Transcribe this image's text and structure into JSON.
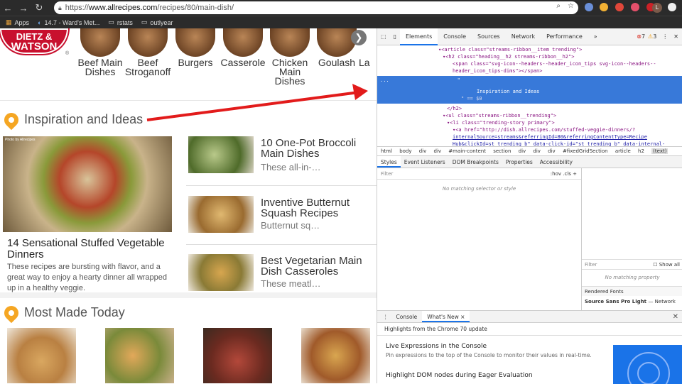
{
  "browser": {
    "url_prefix": "https://",
    "url_host": "www.allrecipes.com",
    "url_path": "/recipes/80/main-dish/",
    "back_icon": "arrow-left-icon",
    "forward_icon": "arrow-right-icon",
    "reload_icon": "reload-icon",
    "avatar_letter": "L",
    "bookmarks": [
      {
        "label": "Apps"
      },
      {
        "label": "14.7 - Ward's Met..."
      },
      {
        "label": "rstats"
      },
      {
        "label": "outlyear"
      }
    ]
  },
  "page": {
    "logo_text_1": "DIETZ &",
    "logo_text_2": "WATSON",
    "logo_reg": "®",
    "categories": [
      {
        "label": "Beef Main Dishes"
      },
      {
        "label": "Beef Stroganoff"
      },
      {
        "label": "Burgers"
      },
      {
        "label": "Casserole"
      },
      {
        "label": "Chicken Main Dishes"
      },
      {
        "label": "Goulash"
      },
      {
        "label": "La"
      }
    ],
    "next_arrow": "❯",
    "inspiration_title": "Inspiration and Ideas",
    "photo_credit": "Photo by Allrecipes",
    "feature_title": "14 Sensational Stuffed Vegetable Dinners",
    "feature_desc": "These recipes are bursting with flavor, and a great way to enjoy a hearty dinner all wrapped up in a healthy veggie.",
    "stories": [
      {
        "title": "10 One-Pot Broccoli Main Dishes",
        "desc": "These all-in-…"
      },
      {
        "title": "Inventive Butternut Squash Recipes",
        "desc": "Butternut sq…"
      },
      {
        "title": "Best Vegetarian Main Dish Casseroles",
        "desc": "These meatl…"
      }
    ],
    "most_made_title": "Most Made Today"
  },
  "devtools": {
    "tabs": [
      "Elements",
      "Console",
      "Sources",
      "Network",
      "Performance",
      "»"
    ],
    "errors": "7",
    "warnings": "3",
    "dom_lines": [
      "<article class=\"streams-ribbon__item trending\">",
      "<h2 class=\"heading__h2 streams-ribbon__h2\">",
      "<span class=\"svg-icon--headers--header_icon_tips svg-icon--headers--",
      "header_icon_tips-dims\"></span>",
      "\"",
      "Inspiration and Ideas",
      "\" == $0",
      "</h2>",
      "<ul class=\"streams-ribbon__trending\">",
      "<li class=\"trending-story primary\">",
      "<a href=\"http://dish.allrecipes.com/stuffed-veggie-dinners/?",
      "internalSource=streams&referringId=80&referringContentType=Recipe",
      "Hub&clickId=st_trending_b\" data-click-id=\"st_trending_b\" data-internal-"
    ],
    "breadcrumbs": [
      "html",
      "body",
      "div",
      "div",
      "#main-content",
      "section",
      "div",
      "div",
      "div",
      "#fixedGridSection",
      "article",
      "h2",
      "(text)"
    ],
    "subtabs": [
      "Styles",
      "Event Listeners",
      "DOM Breakpoints",
      "Properties",
      "Accessibility"
    ],
    "filter_placeholder": "Filter",
    "hov_cls": ":hov  .cls  +",
    "no_matching": "No matching selector or style",
    "filter2": "Filter",
    "show_all": "Show all",
    "no_matching_property": "No matching property",
    "rendered_fonts": "Rendered Fonts",
    "font_name": "Source Sans Pro Light",
    "font_source": "— Network",
    "drawer_tabs": [
      "Console",
      "What's New ×"
    ],
    "highlights": "Highlights from the Chrome 70 update",
    "wn_title1": "Live Expressions in the Console",
    "wn_desc1": "Pin expressions to the top of the Console to monitor their values in real-time.",
    "wn_title2": "Highlight DOM nodes during Eager Evaluation"
  },
  "colors": {
    "accent_blue": "#1a73e8",
    "selection_blue": "#3879d9",
    "logo_red": "#c8102e",
    "pin_orange": "#f5a623",
    "annotation_red": "#e21b1b"
  }
}
